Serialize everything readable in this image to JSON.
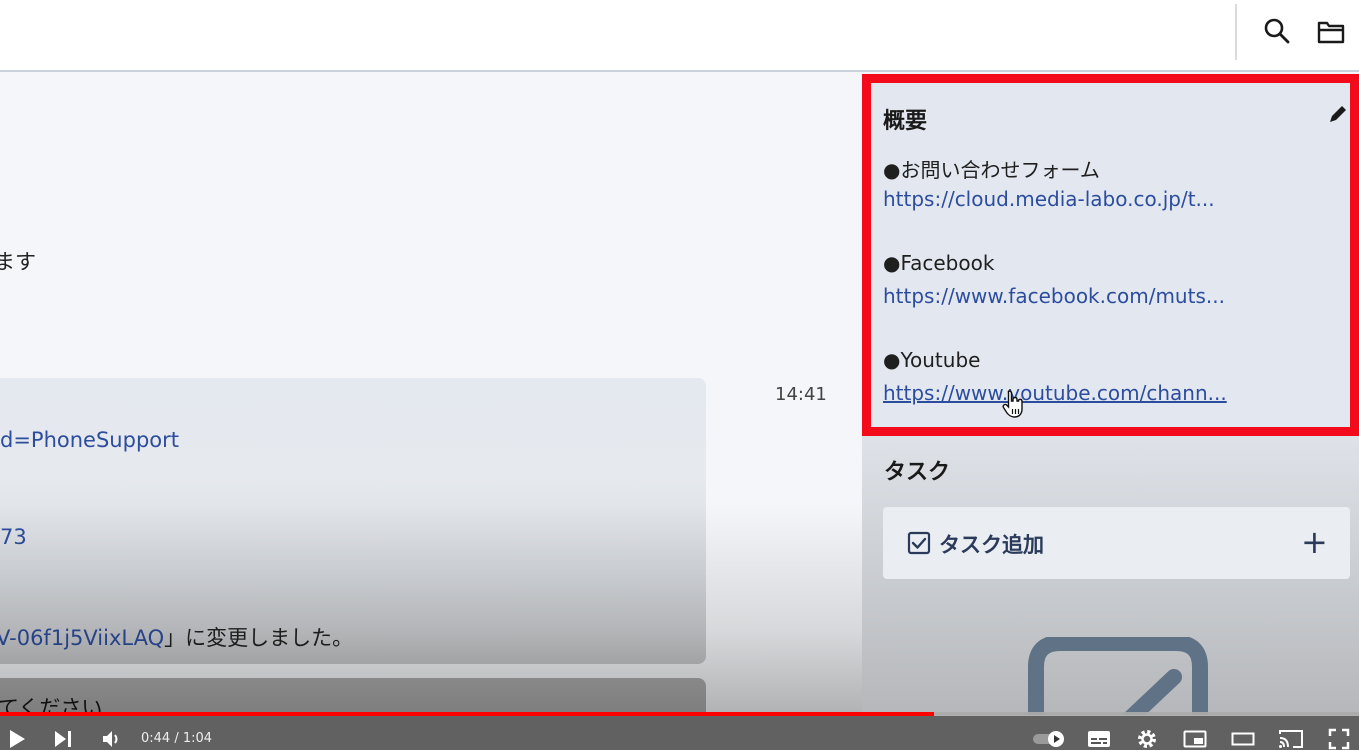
{
  "chat": {
    "fragments": {
      "text_masu": "ます",
      "link_phone": "d=PhoneSupport",
      "link_73": "73",
      "link_code": "V-06f1j5ViixLAQ",
      "changed_text": "」に変更しました。",
      "bottom_text": "てください"
    },
    "time": "14:41"
  },
  "overview": {
    "title": "概要",
    "items": [
      {
        "label": "●お問い合わせフォーム",
        "link": "https://cloud.media-labo.co.jp/t..."
      },
      {
        "label": "●Facebook",
        "link": "https://www.facebook.com/muts..."
      },
      {
        "label": "●Youtube",
        "link": "https://www.youtube.com/chann..."
      }
    ]
  },
  "tasks": {
    "title": "タスク",
    "add_label": "タスク追加",
    "add_icon": "+"
  },
  "player": {
    "time": "0:44 / 1:04",
    "progress": 0.6875
  },
  "colors": {
    "highlight_border": "#f40b1b",
    "link": "#2c4d9e",
    "progress": "#ff0000"
  },
  "icons": [
    "search-icon",
    "folder-icon",
    "pencil-icon",
    "checkbox-icon",
    "plus-icon",
    "hand-cursor-icon",
    "play-icon",
    "next-icon",
    "volume-icon",
    "autoplay-toggle-icon",
    "subtitles-icon",
    "settings-icon",
    "miniplayer-icon",
    "theater-icon",
    "cast-icon",
    "fullscreen-icon"
  ]
}
